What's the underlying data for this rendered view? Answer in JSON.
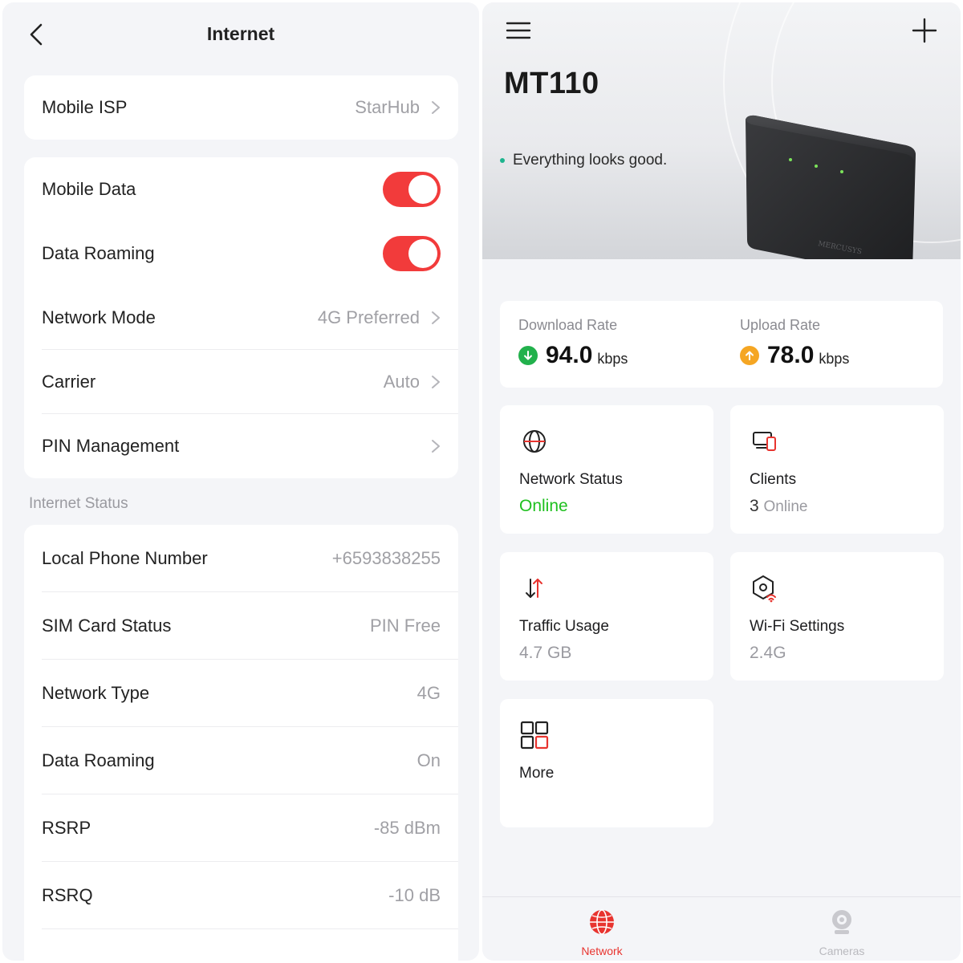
{
  "internet_screen": {
    "title": "Internet",
    "isp": {
      "label": "Mobile ISP",
      "value": "StarHub"
    },
    "settings": [
      {
        "label": "Mobile Data",
        "toggle": true
      },
      {
        "label": "Data Roaming",
        "toggle": true
      },
      {
        "label": "Network Mode",
        "value": "4G Preferred"
      },
      {
        "label": "Carrier",
        "value": "Auto"
      },
      {
        "label": "PIN Management",
        "value": ""
      }
    ],
    "status_section_label": "Internet Status",
    "status_rows": [
      {
        "label": "Local Phone Number",
        "value": "+6593838255"
      },
      {
        "label": "SIM Card Status",
        "value": "PIN Free"
      },
      {
        "label": "Network Type",
        "value": "4G"
      },
      {
        "label": "Data Roaming",
        "value": "On"
      },
      {
        "label": "RSRP",
        "value": "-85 dBm"
      },
      {
        "label": "RSRQ",
        "value": "-10 dB"
      }
    ]
  },
  "network_screen": {
    "device_name": "MT110",
    "status_text": "Everything looks good.",
    "download": {
      "label": "Download Rate",
      "value": "94.0",
      "unit": "kbps",
      "color": "#22b14c"
    },
    "upload": {
      "label": "Upload Rate",
      "value": "78.0",
      "unit": "kbps",
      "color": "#f5a623"
    },
    "tiles": {
      "network_status": {
        "title": "Network Status",
        "value": "Online"
      },
      "clients": {
        "title": "Clients",
        "count": "3",
        "suffix": "Online"
      },
      "traffic_usage": {
        "title": "Traffic Usage",
        "value": "4.7 GB"
      },
      "wifi_settings": {
        "title": "Wi-Fi Settings",
        "value": "2.4G"
      },
      "more": {
        "title": "More"
      }
    },
    "tabs": [
      {
        "label": "Network",
        "active": true,
        "color": "#e8342f"
      },
      {
        "label": "Cameras",
        "active": false,
        "color": "#b9b9be"
      }
    ]
  }
}
